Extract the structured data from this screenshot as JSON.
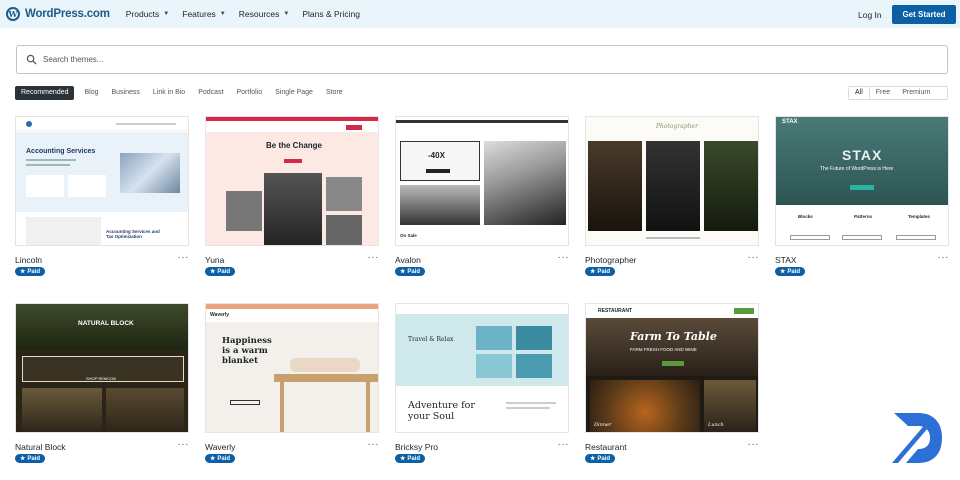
{
  "header": {
    "logo_text": "WordPress.com",
    "nav": [
      {
        "label": "Products",
        "dropdown": true
      },
      {
        "label": "Features",
        "dropdown": true
      },
      {
        "label": "Resources",
        "dropdown": true
      },
      {
        "label": "Plans & Pricing",
        "dropdown": false
      }
    ],
    "login_label": "Log In",
    "cta_label": "Get Started"
  },
  "search": {
    "placeholder": "Search themes..."
  },
  "filters": {
    "categories": [
      "Recommended",
      "Blog",
      "Business",
      "Link in Bio",
      "Podcast",
      "Portfolio",
      "Single Page",
      "Store"
    ],
    "active": "Recommended",
    "pricing": [
      "All",
      "Free",
      "Premium"
    ],
    "pricing_active": "All"
  },
  "themes": [
    {
      "name": "Lincoln",
      "badge": "Paid",
      "preview_text": [
        "Accounting Services",
        "Accounting Services and Tax Optimization"
      ]
    },
    {
      "name": "Yuna",
      "badge": "Paid",
      "preview_text": [
        "Be the Change"
      ]
    },
    {
      "name": "Avalon",
      "badge": "Paid",
      "preview_text": [
        "-40X",
        "On Sale"
      ]
    },
    {
      "name": "Photographer",
      "badge": "Paid",
      "preview_text": [
        "Photographer"
      ]
    },
    {
      "name": "STAX",
      "badge": "Paid",
      "preview_text": [
        "STAX",
        "The Future of WordPress is Here",
        "Blocks",
        "Patterns",
        "Templates"
      ]
    },
    {
      "name": "Natural Block",
      "badge": "Paid",
      "preview_text": [
        "NATURAL BLOCK",
        "SHOP REMCOB"
      ]
    },
    {
      "name": "Waverly",
      "badge": "Paid",
      "preview_text": [
        "Happiness is a warm blanket"
      ]
    },
    {
      "name": "Bricksy Pro",
      "badge": "Paid",
      "preview_text": [
        "Travel & Relax",
        "Adventure for your Soul"
      ]
    },
    {
      "name": "Restaurant",
      "badge": "Paid",
      "preview_text": [
        "RESTAURANT",
        "Farm To Table",
        "FARM FRESH FOOD AND WINE",
        "Dinner",
        "Lunch"
      ]
    }
  ],
  "more_label": "···",
  "colors": {
    "brand": "#1e5a8a",
    "accent": "#0b5fa5",
    "topbar": "#eaf4fb",
    "active_filter": "#2c3338"
  }
}
